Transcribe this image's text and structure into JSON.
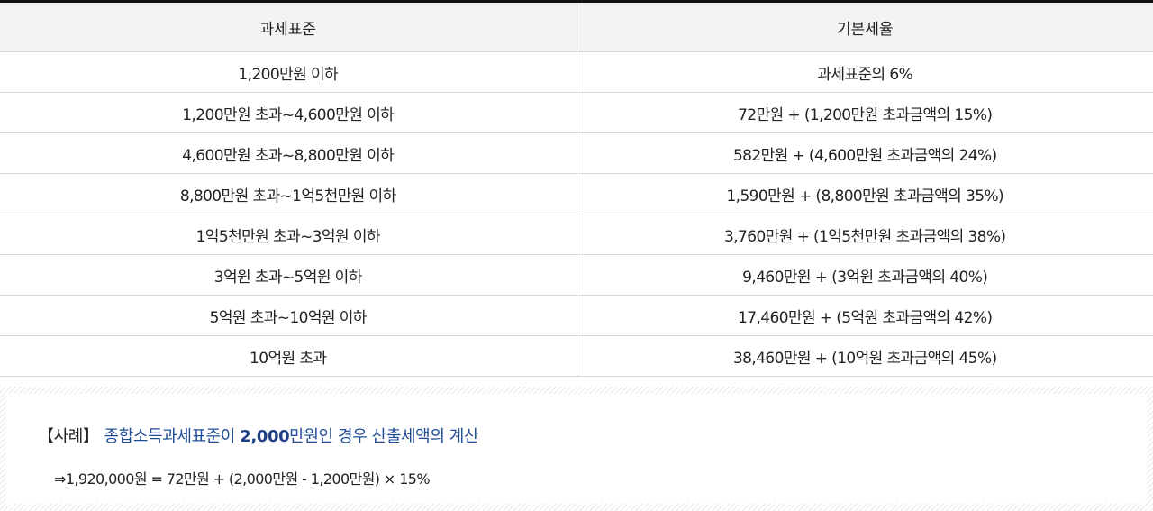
{
  "table": {
    "headers": [
      "과세표준",
      "기본세율"
    ],
    "rows": [
      {
        "base": "1,200만원 이하",
        "rate": "과세표준의 6%"
      },
      {
        "base": "1,200만원 초과~4,600만원 이하",
        "rate": "72만원 + (1,200만원 초과금액의 15%)"
      },
      {
        "base": "4,600만원 초과~8,800만원 이하",
        "rate": "582만원 + (4,600만원 초과금액의 24%)"
      },
      {
        "base": "8,800만원 초과~1억5천만원 이하",
        "rate": "1,590만원 + (8,800만원 초과금액의 35%)"
      },
      {
        "base": "1억5천만원 초과~3억원 이하",
        "rate": "3,760만원 + (1억5천만원 초과금액의 38%)"
      },
      {
        "base": "3억원 초과~5억원 이하",
        "rate": "9,460만원 + (3억원 초과금액의 40%)"
      },
      {
        "base": "5억원 초과~10억원 이하",
        "rate": "17,460만원 + (5억원 초과금액의 42%)"
      },
      {
        "base": "10억원 초과",
        "rate": "38,460만원 + (10억원 초과금액의 45%)"
      }
    ]
  },
  "example": {
    "tag": "【사례】",
    "desc_before": "종합소득과세표준이 ",
    "desc_strong": "2,000",
    "desc_after": "만원인 경우 산출세액의 계산",
    "formula": "⇒1,920,000원 = 72만원 + (2,000만원 - 1,200만원) × 15%"
  },
  "colors": {
    "header_bg": "#f3f3f3",
    "top_rule": "#111111",
    "example_blue": "#1f4c96"
  }
}
